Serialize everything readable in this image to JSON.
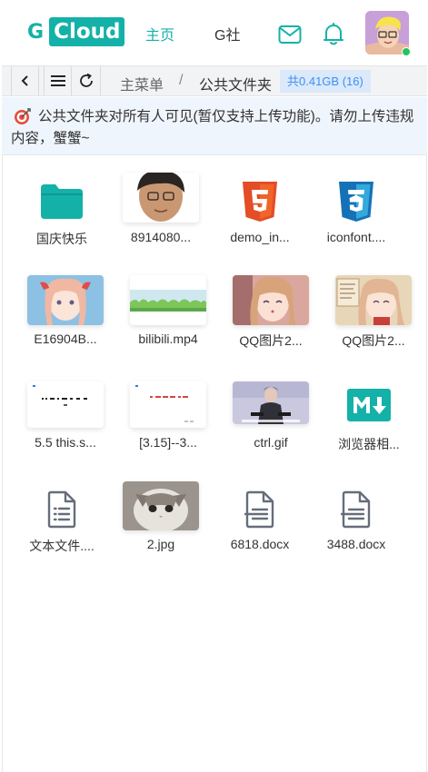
{
  "brand": {
    "g": "G",
    "cloud": "Cloud"
  },
  "nav": {
    "home": "主页",
    "community": "G社"
  },
  "toolbar": {
    "breadcrumb_root": "主菜单",
    "breadcrumb_sep": "/",
    "breadcrumb_current": "公共文件夹",
    "size_badge": "共0.41GB (16)"
  },
  "notice": {
    "icon": "target-icon",
    "text": "公共文件夹对所有人可见(暂仅支持上传功能)。请勿上传违规内容，蟹蟹~"
  },
  "colors": {
    "accent": "#14b1a8",
    "badge_text": "#3d8ff5",
    "badge_bg": "#dbe9fa",
    "notice_bg": "#eff5fc"
  },
  "files": [
    {
      "name": "国庆快乐",
      "type": "folder"
    },
    {
      "name": "8914080...",
      "type": "image"
    },
    {
      "name": "demo_in...",
      "type": "html"
    },
    {
      "name": "iconfont....",
      "type": "css"
    },
    {
      "name": "E16904B...",
      "type": "image"
    },
    {
      "name": "bilibili.mp4",
      "type": "video"
    },
    {
      "name": "QQ图片2...",
      "type": "image"
    },
    {
      "name": "QQ图片2...",
      "type": "image"
    },
    {
      "name": "5.5 this.s...",
      "type": "image"
    },
    {
      "name": "[3.15]--3...",
      "type": "image"
    },
    {
      "name": "ctrl.gif",
      "type": "gif"
    },
    {
      "name": "浏览器相...",
      "type": "markdown"
    },
    {
      "name": "文本文件....",
      "type": "text"
    },
    {
      "name": "2.jpg",
      "type": "image"
    },
    {
      "name": "6818.docx",
      "type": "docx"
    },
    {
      "name": "3488.docx",
      "type": "docx"
    }
  ]
}
